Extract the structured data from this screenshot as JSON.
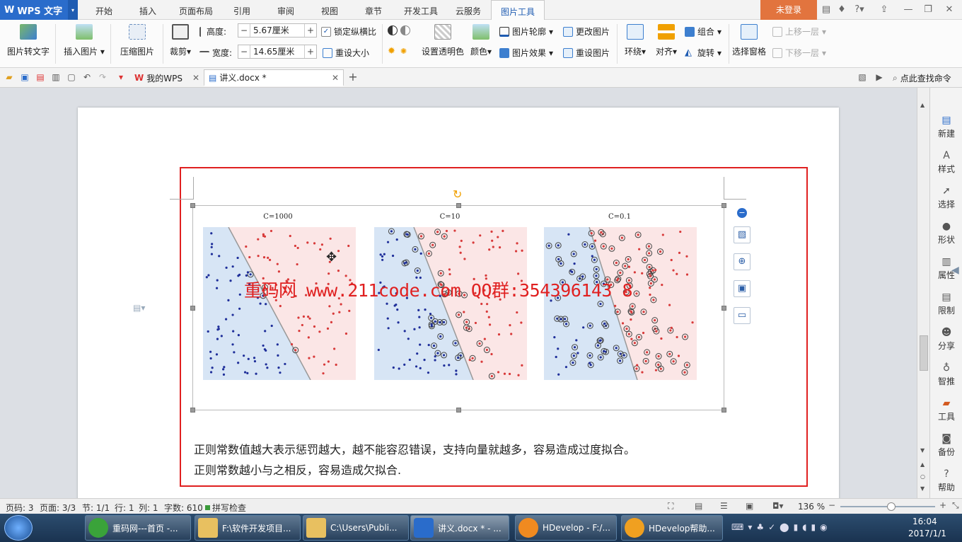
{
  "app": {
    "name": "WPS 文字",
    "login": "未登录"
  },
  "menu_tabs": [
    "开始",
    "插入",
    "页面布局",
    "引用",
    "审阅",
    "视图",
    "章节",
    "开发工具",
    "云服务",
    "图片工具"
  ],
  "active_tab": "图片工具",
  "ribbon": {
    "pic_to_text": "图片转文字",
    "insert_pic": "插入图片",
    "compress_pic": "压缩图片",
    "crop": "裁剪",
    "height_label": "高度:",
    "height_value": "5.67厘米",
    "width_label": "宽度:",
    "width_value": "14.65厘米",
    "lock_ratio": "锁定纵横比",
    "reset_size": "重设大小",
    "set_transparent": "设置透明色",
    "color": "颜色",
    "pic_outline": "图片轮廓",
    "pic_effect": "图片效果",
    "change_pic": "更改图片",
    "reset_pic": "重设图片",
    "wrap": "环绕",
    "align": "对齐",
    "group": "组合",
    "rotate": "旋转",
    "select_pane": "选择窗格",
    "bring_forward": "上移一层",
    "send_backward": "下移一层"
  },
  "quick_access": {
    "tab_mywps": "我的WPS",
    "tab_doc": "讲义.docx *",
    "search": "点此查找命令"
  },
  "figure": {
    "titles": [
      "C=1000",
      "C=10",
      "C=0.1"
    ],
    "watermark": "重码网 www.211code.com  QQ群:354396143 8"
  },
  "body_text": {
    "line1": "正则常数值越大表示惩罚越大，越不能容忍错误，支持向量就越多，容易造成过度拟合。",
    "line2": "正则常数越小与之相反，容易造成欠拟合."
  },
  "right_panel": [
    "新建",
    "样式",
    "选择",
    "形状",
    "属性",
    "限制",
    "分享",
    "智推",
    "工具",
    "备份",
    "帮助"
  ],
  "status": {
    "page_code": "页码: 3",
    "page": "页面: 3/3",
    "section": "节: 1/1",
    "row": "行: 1",
    "col": "列: 1",
    "words": "字数: 610",
    "spell": "拼写检查",
    "zoom": "136 %"
  },
  "taskbar": {
    "items": [
      "重码网---首页 -...",
      "F:\\软件开发项目...",
      "C:\\Users\\Publi...",
      "讲义.docx * - ...",
      "HDevelop - F:/...",
      "HDevelop帮助..."
    ],
    "time": "16:04",
    "date": "2017/1/1"
  },
  "colors": {
    "blue_region": "#d7e5f5",
    "red_region": "#fbe6e6",
    "blue_dot": "#1f2f9a",
    "red_dot": "#d83a3a",
    "accent": "#2a6ccb",
    "frame": "#e02020"
  }
}
